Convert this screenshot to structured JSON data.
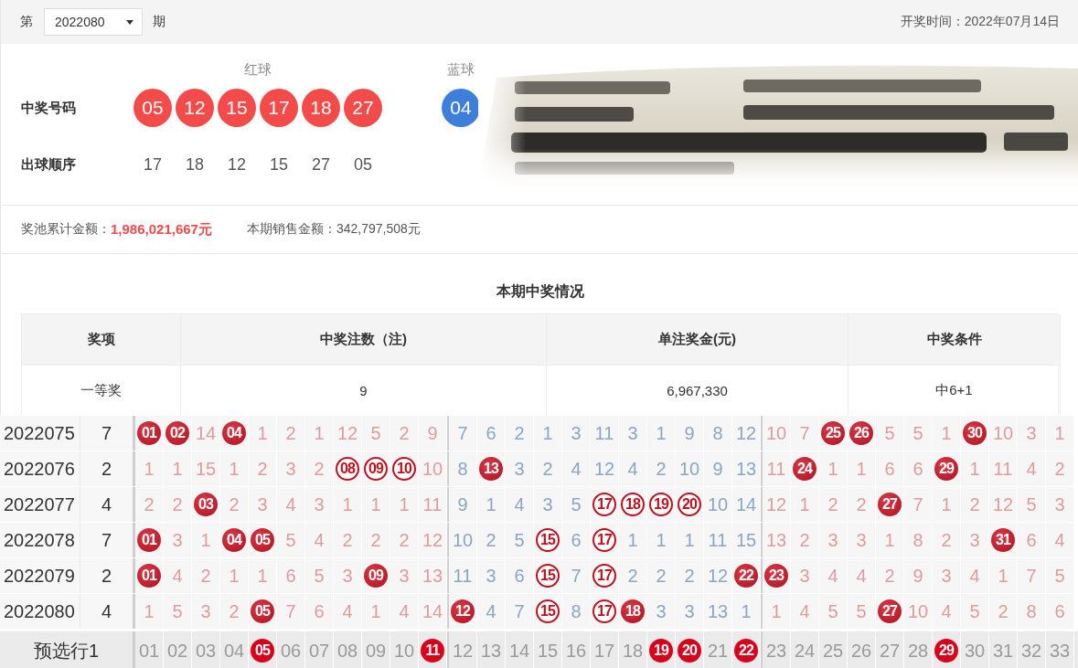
{
  "header": {
    "prefix": "第",
    "issue": "2022080",
    "suffix": "期",
    "draw_date": "开奖时间：2022年07月14日"
  },
  "draw": {
    "red_label": "红球",
    "blue_label": "蓝球",
    "numbers_label": "中奖号码",
    "order_label": "出球顺序",
    "balls": [
      {
        "kind": "red",
        "text": "05"
      },
      {
        "kind": "red",
        "text": "12"
      },
      {
        "kind": "red",
        "text": "15"
      },
      {
        "kind": "red",
        "text": "17"
      },
      {
        "kind": "red",
        "text": "18"
      },
      {
        "kind": "red",
        "text": "27"
      },
      {
        "kind": "blue",
        "text": "04"
      }
    ],
    "order": [
      "17",
      "18",
      "12",
      "15",
      "27",
      "05"
    ],
    "ticket": {
      "kind": "picture"
    }
  },
  "pool": {
    "pool_label": "奖池累计金额：",
    "pool_value": "1,986,021,667元",
    "sales_label": "本期销售金额：",
    "sales_value": "342,797,508元"
  },
  "prize_table": {
    "title": "本期中奖情况",
    "columns": [
      "奖项",
      "中奖注数（注)",
      "单注奖金(元)",
      "中奖条件"
    ],
    "rows": [
      [
        "一等奖",
        "9",
        "6,967,330",
        "中6+1"
      ]
    ]
  },
  "trend_chart": {
    "rows": [
      {
        "period": "2022075",
        "count": "7",
        "cells": [
          {
            "kind": "ball",
            "text": "01"
          },
          {
            "kind": "ball",
            "text": "02"
          },
          {
            "kind": "miss",
            "text": "14"
          },
          {
            "kind": "ball",
            "text": "04"
          },
          {
            "kind": "miss",
            "text": "1"
          },
          {
            "kind": "miss",
            "text": "2"
          },
          {
            "kind": "miss",
            "text": "1"
          },
          {
            "kind": "miss",
            "text": "12"
          },
          {
            "kind": "miss",
            "text": "5"
          },
          {
            "kind": "miss",
            "text": "2"
          },
          {
            "kind": "miss",
            "text": "9"
          },
          {
            "kind": "miss",
            "text": "7"
          },
          {
            "kind": "miss",
            "text": "6"
          },
          {
            "kind": "miss",
            "text": "2"
          },
          {
            "kind": "miss",
            "text": "1"
          },
          {
            "kind": "miss",
            "text": "3"
          },
          {
            "kind": "miss",
            "text": "11"
          },
          {
            "kind": "miss",
            "text": "3"
          },
          {
            "kind": "miss",
            "text": "1"
          },
          {
            "kind": "miss",
            "text": "9"
          },
          {
            "kind": "miss",
            "text": "8"
          },
          {
            "kind": "miss",
            "text": "12"
          },
          {
            "kind": "miss",
            "text": "10"
          },
          {
            "kind": "miss",
            "text": "7"
          },
          {
            "kind": "ball",
            "text": "25"
          },
          {
            "kind": "ball",
            "text": "26"
          },
          {
            "kind": "miss",
            "text": "5"
          },
          {
            "kind": "miss",
            "text": "5"
          },
          {
            "kind": "miss",
            "text": "1"
          },
          {
            "kind": "ball",
            "text": "30"
          },
          {
            "kind": "miss",
            "text": "10"
          },
          {
            "kind": "miss",
            "text": "3"
          },
          {
            "kind": "miss",
            "text": "1"
          }
        ]
      },
      {
        "period": "2022076",
        "count": "2",
        "cells": [
          {
            "kind": "miss",
            "text": "1"
          },
          {
            "kind": "miss",
            "text": "1"
          },
          {
            "kind": "miss",
            "text": "15"
          },
          {
            "kind": "miss",
            "text": "1"
          },
          {
            "kind": "miss",
            "text": "2"
          },
          {
            "kind": "miss",
            "text": "3"
          },
          {
            "kind": "miss",
            "text": "2"
          },
          {
            "kind": "ring",
            "text": "08"
          },
          {
            "kind": "ring",
            "text": "09"
          },
          {
            "kind": "ring",
            "text": "10"
          },
          {
            "kind": "miss",
            "text": "10"
          },
          {
            "kind": "miss",
            "text": "8"
          },
          {
            "kind": "ball",
            "text": "13"
          },
          {
            "kind": "miss",
            "text": "3"
          },
          {
            "kind": "miss",
            "text": "2"
          },
          {
            "kind": "miss",
            "text": "4"
          },
          {
            "kind": "miss",
            "text": "12"
          },
          {
            "kind": "miss",
            "text": "4"
          },
          {
            "kind": "miss",
            "text": "2"
          },
          {
            "kind": "miss",
            "text": "10"
          },
          {
            "kind": "miss",
            "text": "9"
          },
          {
            "kind": "miss",
            "text": "13"
          },
          {
            "kind": "miss",
            "text": "11"
          },
          {
            "kind": "ball",
            "text": "24"
          },
          {
            "kind": "miss",
            "text": "1"
          },
          {
            "kind": "miss",
            "text": "1"
          },
          {
            "kind": "miss",
            "text": "6"
          },
          {
            "kind": "miss",
            "text": "6"
          },
          {
            "kind": "ball",
            "text": "29"
          },
          {
            "kind": "miss",
            "text": "1"
          },
          {
            "kind": "miss",
            "text": "11"
          },
          {
            "kind": "miss",
            "text": "4"
          },
          {
            "kind": "miss",
            "text": "2"
          }
        ]
      },
      {
        "period": "2022077",
        "count": "4",
        "cells": [
          {
            "kind": "miss",
            "text": "2"
          },
          {
            "kind": "miss",
            "text": "2"
          },
          {
            "kind": "ball",
            "text": "03"
          },
          {
            "kind": "miss",
            "text": "2"
          },
          {
            "kind": "miss",
            "text": "3"
          },
          {
            "kind": "miss",
            "text": "4"
          },
          {
            "kind": "miss",
            "text": "3"
          },
          {
            "kind": "miss",
            "text": "1"
          },
          {
            "kind": "miss",
            "text": "1"
          },
          {
            "kind": "miss",
            "text": "1"
          },
          {
            "kind": "miss",
            "text": "11"
          },
          {
            "kind": "miss",
            "text": "9"
          },
          {
            "kind": "miss",
            "text": "1"
          },
          {
            "kind": "miss",
            "text": "4"
          },
          {
            "kind": "miss",
            "text": "3"
          },
          {
            "kind": "miss",
            "text": "5"
          },
          {
            "kind": "ring",
            "text": "17"
          },
          {
            "kind": "ring",
            "text": "18"
          },
          {
            "kind": "ring",
            "text": "19"
          },
          {
            "kind": "ring",
            "text": "20"
          },
          {
            "kind": "miss",
            "text": "10"
          },
          {
            "kind": "miss",
            "text": "14"
          },
          {
            "kind": "miss",
            "text": "12"
          },
          {
            "kind": "miss",
            "text": "1"
          },
          {
            "kind": "miss",
            "text": "2"
          },
          {
            "kind": "miss",
            "text": "2"
          },
          {
            "kind": "ball",
            "text": "27"
          },
          {
            "kind": "miss",
            "text": "7"
          },
          {
            "kind": "miss",
            "text": "1"
          },
          {
            "kind": "miss",
            "text": "2"
          },
          {
            "kind": "miss",
            "text": "12"
          },
          {
            "kind": "miss",
            "text": "5"
          },
          {
            "kind": "miss",
            "text": "3"
          }
        ]
      },
      {
        "period": "2022078",
        "count": "7",
        "cells": [
          {
            "kind": "ball",
            "text": "01"
          },
          {
            "kind": "miss",
            "text": "3"
          },
          {
            "kind": "miss",
            "text": "1"
          },
          {
            "kind": "ball",
            "text": "04"
          },
          {
            "kind": "ball",
            "text": "05"
          },
          {
            "kind": "miss",
            "text": "5"
          },
          {
            "kind": "miss",
            "text": "4"
          },
          {
            "kind": "miss",
            "text": "2"
          },
          {
            "kind": "miss",
            "text": "2"
          },
          {
            "kind": "miss",
            "text": "2"
          },
          {
            "kind": "miss",
            "text": "12"
          },
          {
            "kind": "miss",
            "text": "10"
          },
          {
            "kind": "miss",
            "text": "2"
          },
          {
            "kind": "miss",
            "text": "5"
          },
          {
            "kind": "ring",
            "text": "15"
          },
          {
            "kind": "miss",
            "text": "6"
          },
          {
            "kind": "ring",
            "text": "17"
          },
          {
            "kind": "miss",
            "text": "1"
          },
          {
            "kind": "miss",
            "text": "1"
          },
          {
            "kind": "miss",
            "text": "1"
          },
          {
            "kind": "miss",
            "text": "11"
          },
          {
            "kind": "miss",
            "text": "15"
          },
          {
            "kind": "miss",
            "text": "13"
          },
          {
            "kind": "miss",
            "text": "2"
          },
          {
            "kind": "miss",
            "text": "3"
          },
          {
            "kind": "miss",
            "text": "3"
          },
          {
            "kind": "miss",
            "text": "1"
          },
          {
            "kind": "miss",
            "text": "8"
          },
          {
            "kind": "miss",
            "text": "2"
          },
          {
            "kind": "miss",
            "text": "3"
          },
          {
            "kind": "ball",
            "text": "31"
          },
          {
            "kind": "miss",
            "text": "6"
          },
          {
            "kind": "miss",
            "text": "4"
          }
        ]
      },
      {
        "period": "2022079",
        "count": "2",
        "cells": [
          {
            "kind": "ball",
            "text": "01"
          },
          {
            "kind": "miss",
            "text": "4"
          },
          {
            "kind": "miss",
            "text": "2"
          },
          {
            "kind": "miss",
            "text": "1"
          },
          {
            "kind": "miss",
            "text": "1"
          },
          {
            "kind": "miss",
            "text": "6"
          },
          {
            "kind": "miss",
            "text": "5"
          },
          {
            "kind": "miss",
            "text": "3"
          },
          {
            "kind": "ball",
            "text": "09"
          },
          {
            "kind": "miss",
            "text": "3"
          },
          {
            "kind": "miss",
            "text": "13"
          },
          {
            "kind": "miss",
            "text": "11"
          },
          {
            "kind": "miss",
            "text": "3"
          },
          {
            "kind": "miss",
            "text": "6"
          },
          {
            "kind": "ring",
            "text": "15"
          },
          {
            "kind": "miss",
            "text": "7"
          },
          {
            "kind": "ring",
            "text": "17"
          },
          {
            "kind": "miss",
            "text": "2"
          },
          {
            "kind": "miss",
            "text": "2"
          },
          {
            "kind": "miss",
            "text": "2"
          },
          {
            "kind": "miss",
            "text": "12"
          },
          {
            "kind": "ball",
            "text": "22"
          },
          {
            "kind": "ball",
            "text": "23"
          },
          {
            "kind": "miss",
            "text": "3"
          },
          {
            "kind": "miss",
            "text": "4"
          },
          {
            "kind": "miss",
            "text": "4"
          },
          {
            "kind": "miss",
            "text": "2"
          },
          {
            "kind": "miss",
            "text": "9"
          },
          {
            "kind": "miss",
            "text": "3"
          },
          {
            "kind": "miss",
            "text": "4"
          },
          {
            "kind": "miss",
            "text": "1"
          },
          {
            "kind": "miss",
            "text": "7"
          },
          {
            "kind": "miss",
            "text": "5"
          }
        ]
      },
      {
        "period": "2022080",
        "count": "4",
        "cells": [
          {
            "kind": "miss",
            "text": "1"
          },
          {
            "kind": "miss",
            "text": "5"
          },
          {
            "kind": "miss",
            "text": "3"
          },
          {
            "kind": "miss",
            "text": "2"
          },
          {
            "kind": "ball",
            "text": "05"
          },
          {
            "kind": "miss",
            "text": "7"
          },
          {
            "kind": "miss",
            "text": "6"
          },
          {
            "kind": "miss",
            "text": "4"
          },
          {
            "kind": "miss",
            "text": "1"
          },
          {
            "kind": "miss",
            "text": "4"
          },
          {
            "kind": "miss",
            "text": "14"
          },
          {
            "kind": "ball",
            "text": "12"
          },
          {
            "kind": "miss",
            "text": "4"
          },
          {
            "kind": "miss",
            "text": "7"
          },
          {
            "kind": "ring",
            "text": "15"
          },
          {
            "kind": "miss",
            "text": "8"
          },
          {
            "kind": "ring",
            "text": "17"
          },
          {
            "kind": "ball",
            "text": "18"
          },
          {
            "kind": "miss",
            "text": "3"
          },
          {
            "kind": "miss",
            "text": "3"
          },
          {
            "kind": "miss",
            "text": "13"
          },
          {
            "kind": "miss",
            "text": "1"
          },
          {
            "kind": "miss",
            "text": "1"
          },
          {
            "kind": "miss",
            "text": "4"
          },
          {
            "kind": "miss",
            "text": "5"
          },
          {
            "kind": "miss",
            "text": "5"
          },
          {
            "kind": "ball",
            "text": "27"
          },
          {
            "kind": "miss",
            "text": "10"
          },
          {
            "kind": "miss",
            "text": "4"
          },
          {
            "kind": "miss",
            "text": "5"
          },
          {
            "kind": "miss",
            "text": "2"
          },
          {
            "kind": "miss",
            "text": "8"
          },
          {
            "kind": "miss",
            "text": "6"
          }
        ]
      }
    ],
    "preselect": {
      "label": "预选行1",
      "cells": [
        {
          "text": "01",
          "selected": false
        },
        {
          "text": "02",
          "selected": false
        },
        {
          "text": "03",
          "selected": false
        },
        {
          "text": "04",
          "selected": false
        },
        {
          "text": "05",
          "selected": true
        },
        {
          "text": "06",
          "selected": false
        },
        {
          "text": "07",
          "selected": false
        },
        {
          "text": "08",
          "selected": false
        },
        {
          "text": "09",
          "selected": false
        },
        {
          "text": "10",
          "selected": false
        },
        {
          "text": "11",
          "selected": true
        },
        {
          "text": "12",
          "selected": false
        },
        {
          "text": "13",
          "selected": false
        },
        {
          "text": "14",
          "selected": false
        },
        {
          "text": "15",
          "selected": false
        },
        {
          "text": "16",
          "selected": false
        },
        {
          "text": "17",
          "selected": false
        },
        {
          "text": "18",
          "selected": false
        },
        {
          "text": "19",
          "selected": true
        },
        {
          "text": "20",
          "selected": true
        },
        {
          "text": "21",
          "selected": false
        },
        {
          "text": "22",
          "selected": true
        },
        {
          "text": "23",
          "selected": false
        },
        {
          "text": "24",
          "selected": false
        },
        {
          "text": "25",
          "selected": false
        },
        {
          "text": "26",
          "selected": false
        },
        {
          "text": "27",
          "selected": false
        },
        {
          "text": "28",
          "selected": false
        },
        {
          "text": "29",
          "selected": true
        },
        {
          "text": "30",
          "selected": false
        },
        {
          "text": "31",
          "selected": false
        },
        {
          "text": "32",
          "selected": false
        },
        {
          "text": "33",
          "selected": false
        }
      ]
    }
  }
}
